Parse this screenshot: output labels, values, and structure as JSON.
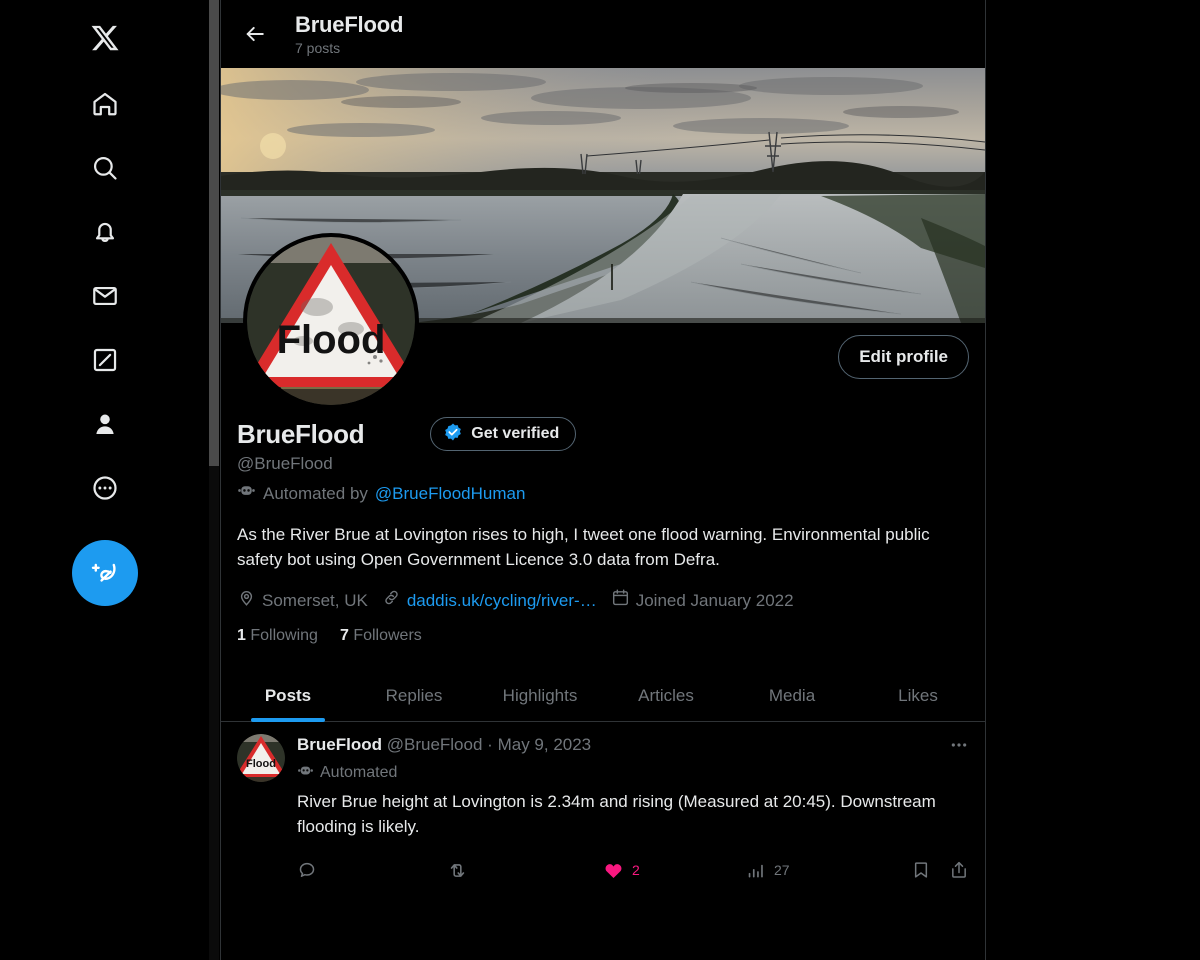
{
  "nav": {
    "items": [
      {
        "name": "x-logo",
        "label": "X"
      },
      {
        "name": "home",
        "label": "Home"
      },
      {
        "name": "search",
        "label": "Search"
      },
      {
        "name": "notifications",
        "label": "Notifications"
      },
      {
        "name": "messages",
        "label": "Messages"
      },
      {
        "name": "grok",
        "label": "Grok"
      },
      {
        "name": "profile",
        "label": "Profile"
      },
      {
        "name": "more",
        "label": "More"
      }
    ],
    "compose_label": "Post"
  },
  "header": {
    "back_label": "Back",
    "title": "BrueFlood",
    "post_count": "7 posts"
  },
  "profile": {
    "edit_button": "Edit profile",
    "display_name": "BrueFlood",
    "handle": "@BrueFlood",
    "get_verified": "Get verified",
    "automated_prefix": "Automated by",
    "automated_account": "@BrueFloodHuman",
    "bio": "As the River Brue at Lovington rises to high, I tweet one flood warning. Environmental public safety bot using Open Government Licence 3.0 data from Defra.",
    "location": "Somerset, UK",
    "website": "daddis.uk/cycling/river-…",
    "joined": "Joined January 2022",
    "following_count": "1",
    "following_label": "Following",
    "followers_count": "7",
    "followers_label": "Followers",
    "avatar_alt": "Flood"
  },
  "tabs": [
    {
      "label": "Posts",
      "active": true
    },
    {
      "label": "Replies",
      "active": false
    },
    {
      "label": "Highlights",
      "active": false
    },
    {
      "label": "Articles",
      "active": false
    },
    {
      "label": "Media",
      "active": false
    },
    {
      "label": "Likes",
      "active": false
    }
  ],
  "tweet": {
    "author": "BrueFlood",
    "handle": "@BrueFlood",
    "separator": "·",
    "date": "May 9, 2023",
    "automated_label": "Automated",
    "text": "River Brue height at Lovington is 2.34m and rising (Measured at 20:45). Downstream flooding is likely.",
    "reply_count": "",
    "retweet_count": "",
    "like_count": "2",
    "view_count": "27",
    "avatar_alt": "Flood"
  },
  "colors": {
    "accent": "#1d9bf0",
    "like": "#f91880",
    "text_primary": "#e7e9ea",
    "text_muted": "#71767b",
    "border": "#2f3336",
    "background": "#000000"
  }
}
